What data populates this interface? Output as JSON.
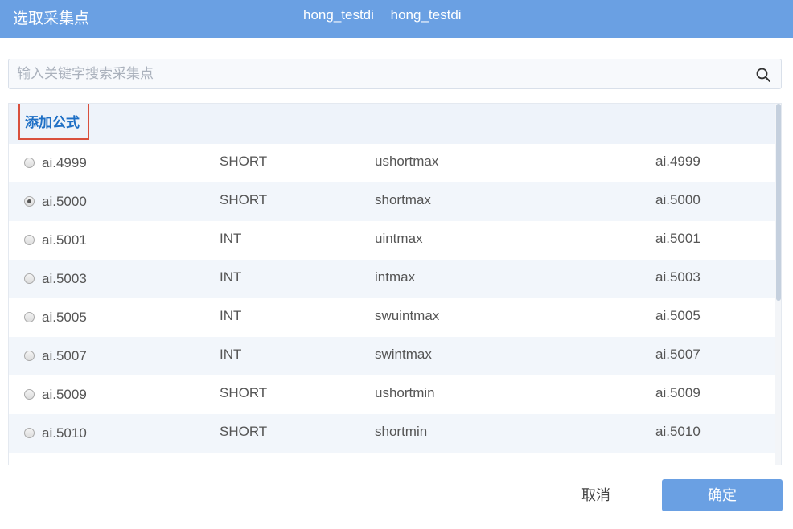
{
  "header": {
    "title": "选取采集点",
    "devices": [
      "hong_testdi",
      "hong_testdi"
    ]
  },
  "search": {
    "placeholder": "输入关键字搜索采集点",
    "icon": "search-icon"
  },
  "list": {
    "formula_button": "添加公式",
    "rows": [
      {
        "name": "ai.4999",
        "type": "SHORT",
        "desc": "ushortmax",
        "tag": "ai.4999",
        "selected": false
      },
      {
        "name": "ai.5000",
        "type": "SHORT",
        "desc": "shortmax",
        "tag": "ai.5000",
        "selected": true
      },
      {
        "name": "ai.5001",
        "type": "INT",
        "desc": "uintmax",
        "tag": "ai.5001",
        "selected": false
      },
      {
        "name": "ai.5003",
        "type": "INT",
        "desc": "intmax",
        "tag": "ai.5003",
        "selected": false
      },
      {
        "name": "ai.5005",
        "type": "INT",
        "desc": "swuintmax",
        "tag": "ai.5005",
        "selected": false
      },
      {
        "name": "ai.5007",
        "type": "INT",
        "desc": "swintmax",
        "tag": "ai.5007",
        "selected": false
      },
      {
        "name": "ai.5009",
        "type": "SHORT",
        "desc": "ushortmin",
        "tag": "ai.5009",
        "selected": false
      },
      {
        "name": "ai.5010",
        "type": "SHORT",
        "desc": "shortmin",
        "tag": "ai.5010",
        "selected": false
      }
    ]
  },
  "footer": {
    "cancel_label": "取消",
    "ok_label": "确定"
  },
  "colors": {
    "accent": "#6aa0e3",
    "formula_text": "#1e6fc5",
    "highlight_border": "#d9503d",
    "row_alt": "#f2f6fb"
  }
}
